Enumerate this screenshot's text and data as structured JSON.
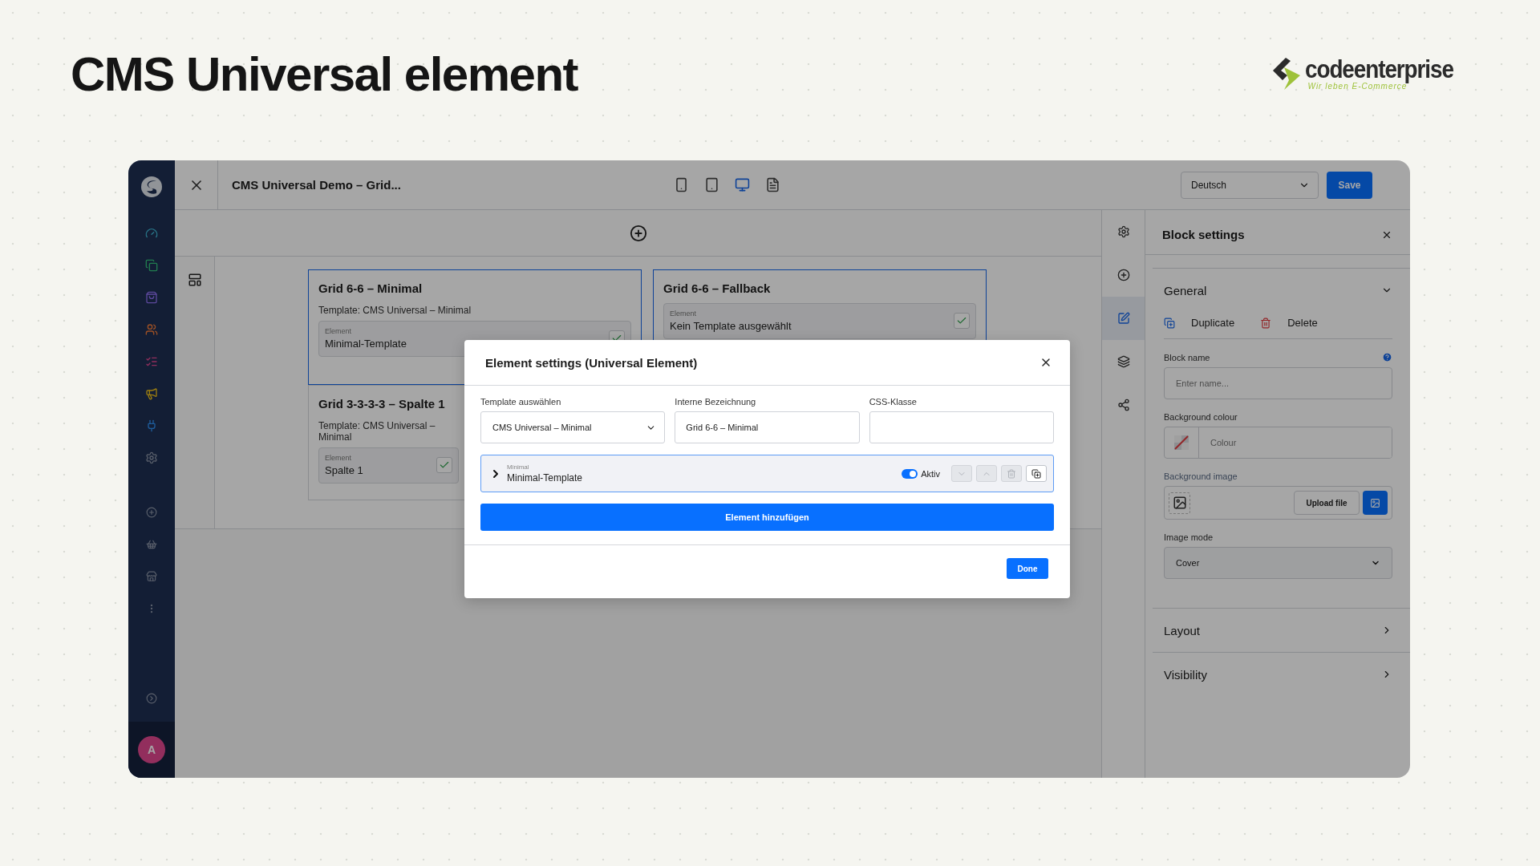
{
  "page_title": "CMS Universal element",
  "brand": {
    "name": "codeenterprise",
    "tagline": "Wir leben E-Commerce"
  },
  "editor": {
    "nav_items": [
      {
        "kind": "dashboard"
      },
      {
        "kind": "catalog"
      },
      {
        "kind": "orders"
      },
      {
        "kind": "customers"
      },
      {
        "kind": "content"
      },
      {
        "kind": "marketing"
      },
      {
        "kind": "extensions"
      },
      {
        "kind": "settings"
      }
    ],
    "nav_extra": [
      {
        "kind": "add"
      },
      {
        "kind": "basket"
      },
      {
        "kind": "store"
      },
      {
        "kind": "more"
      }
    ],
    "avatar": "A",
    "title": "CMS Universal Demo – Grid...",
    "devices": [
      {
        "kind": "mobile",
        "selected": false
      },
      {
        "kind": "tablet",
        "selected": false
      },
      {
        "kind": "desktop",
        "selected": true
      },
      {
        "kind": "list",
        "selected": false
      }
    ],
    "language": "Deutsch",
    "save": "Save",
    "cards": [
      {
        "title": "Grid 6-6 – Minimal",
        "template": "Template: CMS Universal – Minimal",
        "element_label": "Element",
        "element_value": "Minimal-Template",
        "checked": true,
        "selected": true
      },
      {
        "title": "Grid 6-6 – Fallback",
        "element_label": "Element",
        "element_value": "Kein Template ausgewählt",
        "checked": true,
        "selected": true
      },
      {
        "title": "Grid 3-3-3-3 – Spalte 1",
        "template": "Template: CMS Universal – Minimal",
        "element_label": "Element",
        "element_value": "Spalte 1",
        "checked": true,
        "selected": false
      }
    ],
    "side_tools": [
      {
        "kind": "settings",
        "selected": false
      },
      {
        "kind": "add",
        "selected": false
      },
      {
        "kind": "edit",
        "selected": true
      },
      {
        "kind": "layers",
        "selected": false
      },
      {
        "kind": "share",
        "selected": false
      }
    ],
    "panel": {
      "title": "Block settings",
      "general": {
        "title": "General",
        "expanded": true,
        "actions": [
          {
            "kind": "duplicate",
            "label": "Duplicate"
          },
          {
            "kind": "delete",
            "label": "Delete"
          }
        ],
        "block_name": {
          "label": "Block name",
          "placeholder": "Enter name..."
        },
        "background_colour": {
          "label": "Background colour",
          "placeholder": "Colour"
        },
        "background_image": {
          "label": "Background image",
          "button": "Upload file"
        },
        "image_mode": {
          "label": "Image mode",
          "value": "Cover"
        }
      },
      "sections": [
        {
          "title": "Layout",
          "expanded": false
        },
        {
          "title": "Visibility",
          "expanded": false
        }
      ]
    },
    "modal": {
      "title": "Element settings (Universal Element)",
      "fields": [
        {
          "kind": "select",
          "label": "Template auswählen",
          "value": "CMS Universal – Minimal"
        },
        {
          "kind": "text",
          "label": "Interne Bezeichnung",
          "value": "Grid 6-6 – Minimal"
        },
        {
          "kind": "text",
          "label": "CSS-Klasse"
        }
      ],
      "item": {
        "caption": "Minimal",
        "name": "Minimal-Template",
        "expanded": false,
        "active": true,
        "active_label": "Aktiv",
        "actions": [
          {
            "kind": "down",
            "disabled": true
          },
          {
            "kind": "up",
            "disabled": true
          },
          {
            "kind": "delete",
            "disabled": true
          },
          {
            "kind": "duplicate",
            "disabled": false
          }
        ]
      },
      "add_button": "Element hinzufügen",
      "done": "Done"
    }
  }
}
